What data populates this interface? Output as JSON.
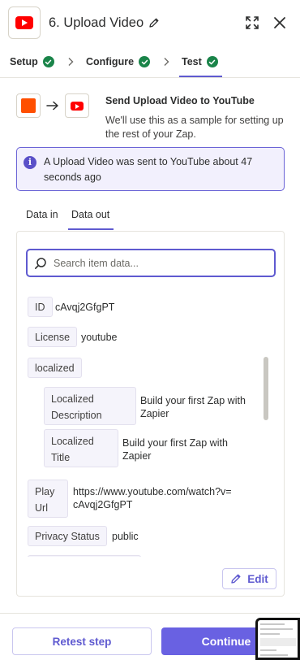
{
  "header": {
    "title": "6. Upload Video",
    "app_icon": "youtube-icon",
    "edit_icon": "pencil-icon",
    "expand_icon": "expand-icon",
    "close_icon": "close-icon"
  },
  "steps": [
    {
      "label": "Setup",
      "complete": true
    },
    {
      "label": "Configure",
      "complete": true
    },
    {
      "label": "Test",
      "complete": true,
      "active": true
    }
  ],
  "intro": {
    "title": "Send Upload Video to YouTube",
    "description": "We'll use this as a sample for setting up the rest of your Zap."
  },
  "info": {
    "icon": "info-icon",
    "message": "A Upload Video was sent to YouTube about 47 seconds ago"
  },
  "data_tabs": [
    {
      "label": "Data in",
      "active": false
    },
    {
      "label": "Data out",
      "active": true
    }
  ],
  "search": {
    "placeholder": "Search item data..."
  },
  "fields": {
    "id": {
      "key": "ID",
      "value": "cAvqj2GfgPT"
    },
    "license": {
      "key": "License",
      "value": "youtube"
    },
    "localized": {
      "key": "localized"
    },
    "localized_description": {
      "key": "Localized Description",
      "value": "Build your first Zap with Zapier"
    },
    "localized_title": {
      "key": "Localized Title",
      "value": "Build your first Zap with Zapier"
    },
    "play_url": {
      "key": "Play Url",
      "value": "https://www.youtube.com/watch?v=cAvqj2GfgPT"
    },
    "privacy_status": {
      "key": "Privacy Status",
      "value": "public"
    }
  },
  "edit_label": "Edit",
  "footer": {
    "retest_label": "Retest step",
    "continue_label": "Continue"
  },
  "colors": {
    "accent": "#5f5ad0",
    "success": "#1a8449",
    "youtube_red": "#ff0000",
    "zapier_orange": "#ff4f00"
  }
}
